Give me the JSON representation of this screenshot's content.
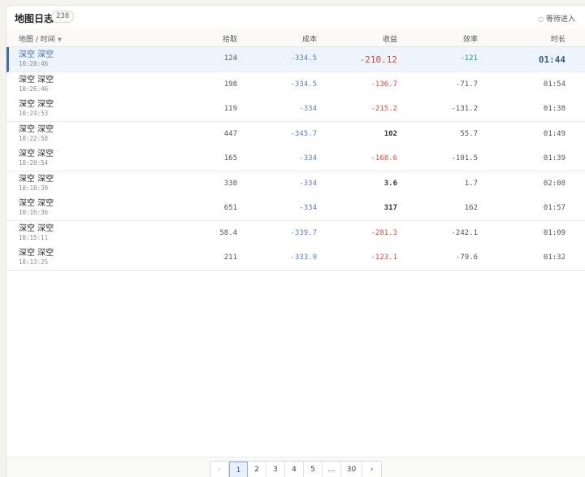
{
  "header": {
    "title": "地图日志",
    "count": "238",
    "status_label": "等待进入"
  },
  "columns": {
    "map_time": "地图 / 时间",
    "pickup": "拾取",
    "cost": "成本",
    "profit": "收益",
    "efficiency": "效率",
    "duration": "时长"
  },
  "rows": [
    {
      "map": "深空 深空",
      "time": "10:28:46",
      "pickup": "124",
      "cost": "-334.5",
      "profit": "-210.12",
      "efficiency": "-121",
      "duration": "01:44"
    },
    {
      "map": "深空 深空",
      "time": "10:26:46",
      "pickup": "198",
      "cost": "-334.5",
      "profit": "-136.7",
      "efficiency": "-71.7",
      "duration": "01:54"
    },
    {
      "map": "深空 深空",
      "time": "10:24:53",
      "pickup": "119",
      "cost": "-334",
      "profit": "-215.2",
      "efficiency": "-131.2",
      "duration": "01:38"
    },
    {
      "map": "深空 深空",
      "time": "10:22:58",
      "pickup": "447",
      "cost": "-345.7",
      "profit": "102",
      "efficiency": "55.7",
      "duration": "01:49"
    },
    {
      "map": "深空 深空",
      "time": "10:20:54",
      "pickup": "165",
      "cost": "-334",
      "profit": "-168.6",
      "efficiency": "-101.5",
      "duration": "01:39"
    },
    {
      "map": "深空 深空",
      "time": "10:18:39",
      "pickup": "338",
      "cost": "-334",
      "profit": "3.6",
      "efficiency": "1.7",
      "duration": "02:08"
    },
    {
      "map": "深空 深空",
      "time": "10:16:36",
      "pickup": "651",
      "cost": "-334",
      "profit": "317",
      "efficiency": "162",
      "duration": "01:57"
    },
    {
      "map": "深空 深空",
      "time": "10:15:11",
      "pickup": "58.4",
      "cost": "-339.7",
      "profit": "-281.3",
      "efficiency": "-242.1",
      "duration": "01:09"
    },
    {
      "map": "深空 深空",
      "time": "10:13:25",
      "pickup": "211",
      "cost": "-333.9",
      "profit": "-123.1",
      "efficiency": "-79.6",
      "duration": "01:32"
    }
  ],
  "pagination": {
    "prev": "‹",
    "pages": [
      "1",
      "2",
      "3",
      "4",
      "5"
    ],
    "ellipsis": "…",
    "last": "30",
    "next": "›",
    "current": "1"
  },
  "colors": {
    "accent": "#3f6fa8",
    "negative": "#d14a3b",
    "positive_efficiency": "#1a9a6b",
    "cost": "#5b7fb0"
  }
}
